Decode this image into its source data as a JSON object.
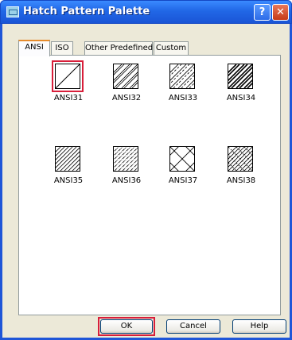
{
  "window": {
    "title": "Hatch Pattern Palette",
    "help_glyph": "?",
    "close_glyph": "✕"
  },
  "tabs": [
    {
      "label": "ANSI",
      "active": true
    },
    {
      "label": "ISO",
      "active": false
    },
    {
      "label": "Other Predefined",
      "active": false
    },
    {
      "label": "Custom",
      "active": false
    }
  ],
  "patterns": [
    {
      "name": "ANSI31",
      "selected": true
    },
    {
      "name": "ANSI32",
      "selected": false
    },
    {
      "name": "ANSI33",
      "selected": false
    },
    {
      "name": "ANSI34",
      "selected": false
    },
    {
      "name": "ANSI35",
      "selected": false
    },
    {
      "name": "ANSI36",
      "selected": false
    },
    {
      "name": "ANSI37",
      "selected": false
    },
    {
      "name": "ANSI38",
      "selected": false
    }
  ],
  "buttons": {
    "ok": "OK",
    "cancel": "Cancel",
    "help": "Help"
  },
  "colors": {
    "title_bar": "#2167e6",
    "highlight": "#d81e3a",
    "tab_accent": "#e68b2c"
  }
}
